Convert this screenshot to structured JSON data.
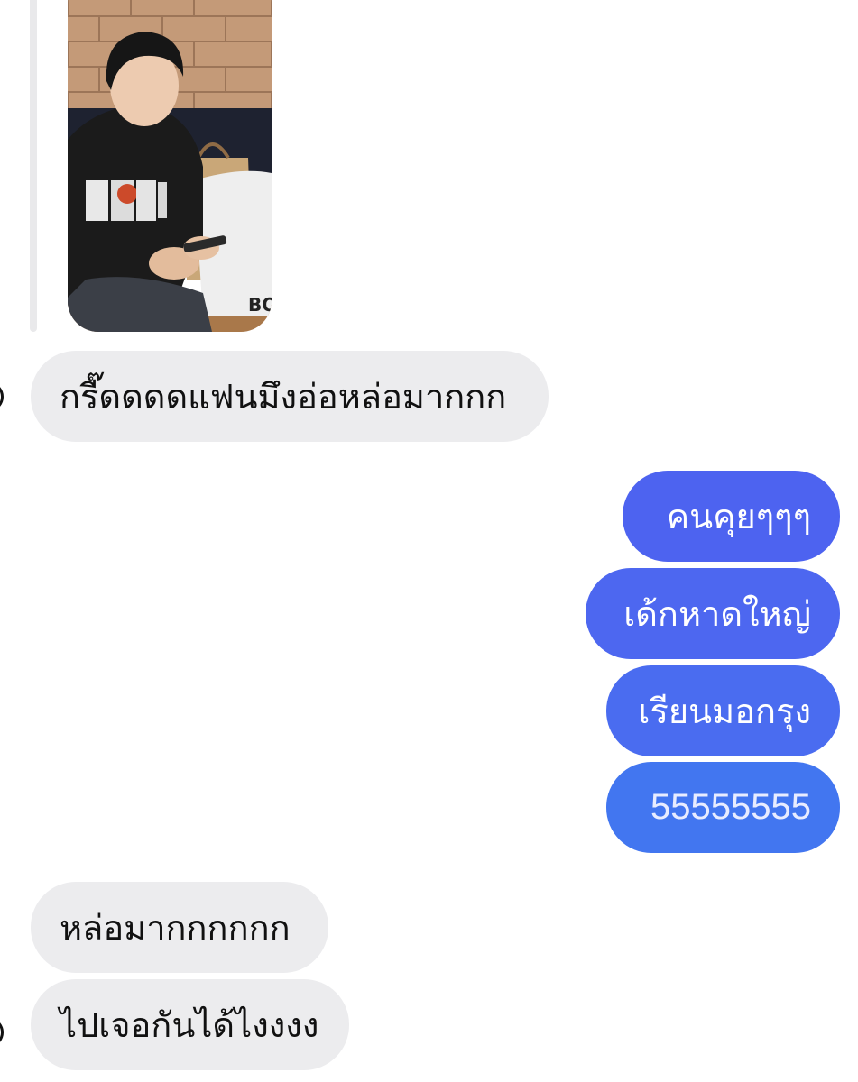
{
  "thread": {
    "received_top": {
      "text": "กรี๊ดดดดแฟนมึงอ่อหล่อมากกก"
    },
    "sent": [
      {
        "text": "คนคุยๆๆๆ",
        "color": "#4d63f0"
      },
      {
        "text": "เด้กหาดใหญ่",
        "color": "#4d67f0"
      },
      {
        "text": "เรียนมอกรุง",
        "color": "#4a6cf0"
      },
      {
        "text": "55555555",
        "color": "#4276f0"
      }
    ],
    "received_bottom": [
      {
        "text": "หล่อมากกกกกก"
      },
      {
        "text": "ไปเจอกันได้ไงงงง"
      }
    ]
  },
  "colors": {
    "received_bubble": "#ececee",
    "sent_bubble_top": "#4d5ff0",
    "sent_bubble_bottom": "#3f78f0"
  }
}
